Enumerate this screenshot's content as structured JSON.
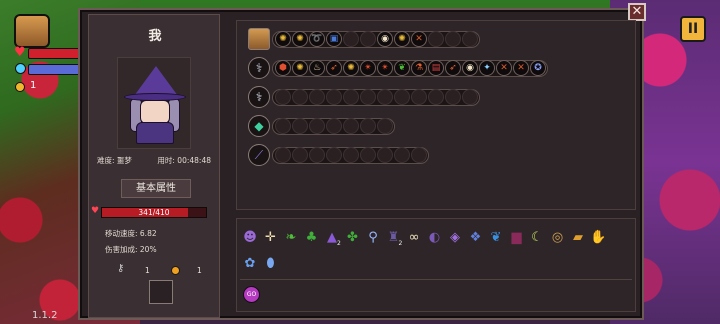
{
  "hud": {
    "coin_count": "1",
    "version": "1.1.2",
    "pause_label": "II"
  },
  "dialog": {
    "close_label": "✕",
    "character": {
      "name": "我",
      "difficulty": "难度: 噩梦",
      "play_time": "用时: 00:48:48",
      "attributes_button": "基本属性",
      "hp": {
        "text": "341/410",
        "current": 341,
        "max": 410
      },
      "stats": [
        {
          "label": "移动速度: 6.82"
        },
        {
          "label": "伤害加成: 20%"
        }
      ],
      "keys": "1",
      "coins": "1"
    },
    "weapon_rows": [
      {
        "main_icon": "chest-icon",
        "slots": [
          {
            "icon": "bee-icon",
            "glyph": "✺",
            "color": "#e8b93a"
          },
          {
            "icon": "bee-icon",
            "glyph": "✺",
            "color": "#e8b93a"
          },
          {
            "icon": "spiral-icon",
            "glyph": "➰",
            "color": "#d97a2a"
          },
          {
            "icon": "book-icon",
            "glyph": "▣",
            "color": "#4a7ad6"
          },
          {
            "icon": "empty",
            "glyph": "",
            "color": ""
          },
          {
            "icon": "empty",
            "glyph": "",
            "color": ""
          },
          {
            "icon": "ghost-icon",
            "glyph": "◉",
            "color": "#f4e6c9"
          },
          {
            "icon": "bee-icon",
            "glyph": "✺",
            "color": "#e8b93a"
          },
          {
            "icon": "crossed-swords-icon",
            "glyph": "✕",
            "color": "#d65a2a"
          },
          {
            "icon": "empty",
            "glyph": "",
            "color": ""
          },
          {
            "icon": "empty",
            "glyph": "",
            "color": ""
          },
          {
            "icon": "empty",
            "glyph": "",
            "color": ""
          }
        ]
      },
      {
        "main_icon": "staff-icon",
        "slots": [
          {
            "icon": "shield-icon",
            "glyph": "⬢",
            "color": "#e05030"
          },
          {
            "icon": "bee-icon",
            "glyph": "✺",
            "color": "#e8b93a"
          },
          {
            "icon": "flame-icon",
            "glyph": "♨",
            "color": "#f0d9b0"
          },
          {
            "icon": "arrow-icon",
            "glyph": "➶",
            "color": "#e06030"
          },
          {
            "icon": "bee-icon",
            "glyph": "✺",
            "color": "#e8b93a"
          },
          {
            "icon": "spikes-icon",
            "glyph": "✴",
            "color": "#e05030"
          },
          {
            "icon": "spikes-icon",
            "glyph": "✴",
            "color": "#e05030"
          },
          {
            "icon": "leaf-icon",
            "glyph": "❦",
            "color": "#4fbf3a"
          },
          {
            "icon": "potion-icon",
            "glyph": "⚗",
            "color": "#e06030"
          },
          {
            "icon": "scroll-icon",
            "glyph": "▤",
            "color": "#d04040"
          },
          {
            "icon": "arrow-icon",
            "glyph": "➶",
            "color": "#e06030"
          },
          {
            "icon": "ghost-icon",
            "glyph": "◉",
            "color": "#f4e6c9"
          },
          {
            "icon": "wings-icon",
            "glyph": "✦",
            "color": "#8ad0ff"
          },
          {
            "icon": "crossed-swords-icon",
            "glyph": "✕",
            "color": "#d65a2a"
          },
          {
            "icon": "crossed-swords-icon",
            "glyph": "✕",
            "color": "#d65a2a"
          },
          {
            "icon": "star-shield-icon",
            "glyph": "✪",
            "color": "#8aa4ff"
          }
        ]
      },
      {
        "main_icon": "wand-icon",
        "slot_count": 12
      },
      {
        "main_icon": "emerald-book-icon",
        "slot_count": 7
      },
      {
        "main_icon": "dagger-icon",
        "slot_count": 9
      }
    ],
    "inventory": {
      "items": [
        {
          "icon": "witch-portrait-icon",
          "glyph": "☻",
          "color": "#9a6ad6"
        },
        {
          "icon": "cross-icon",
          "glyph": "✛",
          "color": "#f0e0b0"
        },
        {
          "icon": "leaves-icon",
          "glyph": "❧",
          "color": "#4fbf3a"
        },
        {
          "icon": "sprout-icon",
          "glyph": "♣",
          "color": "#3fae3a"
        },
        {
          "icon": "witch-hat-icon",
          "glyph": "▲",
          "color": "#8a5ad6",
          "count": "2"
        },
        {
          "icon": "herb-icon",
          "glyph": "✤",
          "color": "#3fae3a"
        },
        {
          "icon": "magnifier-icon",
          "glyph": "⚲",
          "color": "#9ab8ff"
        },
        {
          "icon": "coat-icon",
          "glyph": "♜",
          "color": "#6a5aa0",
          "count": "2"
        },
        {
          "icon": "pearls-icon",
          "glyph": "∞",
          "color": "#f0e8c0"
        },
        {
          "icon": "mask-icon",
          "glyph": "◐",
          "color": "#7a5ab6"
        },
        {
          "icon": "gem-icon",
          "glyph": "◈",
          "color": "#a070e0"
        },
        {
          "icon": "spellbook-icon",
          "glyph": "❖",
          "color": "#6080e0"
        },
        {
          "icon": "feather-icon",
          "glyph": "❦",
          "color": "#3a90e0"
        },
        {
          "icon": "top-hat-icon",
          "glyph": "▆",
          "color": "#8a2a5a"
        },
        {
          "icon": "boomerang-icon",
          "glyph": "☾",
          "color": "#c8e060"
        },
        {
          "icon": "amulet-icon",
          "glyph": "◎",
          "color": "#d0a050"
        },
        {
          "icon": "ticket-icon",
          "glyph": "▰",
          "color": "#e0a030"
        },
        {
          "icon": "glove-icon",
          "glyph": "✋",
          "color": "#f0e8d0"
        },
        {
          "icon": "blue-lotus-icon",
          "glyph": "✿",
          "color": "#6aa0f0"
        },
        {
          "icon": "egg-icon",
          "glyph": "⬮",
          "color": "#7aa8f0"
        }
      ],
      "orb_label": "GO"
    }
  }
}
